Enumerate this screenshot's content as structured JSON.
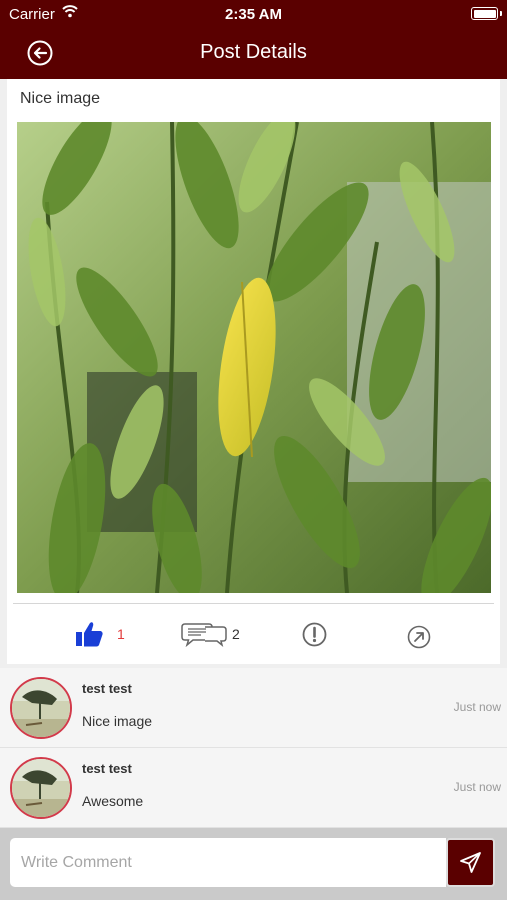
{
  "status_bar": {
    "carrier": "Carrier",
    "time": "2:35 AM",
    "wifi_icon": "wifi-icon",
    "battery_icon": "battery-icon"
  },
  "header": {
    "title": "Post Details",
    "back_icon": "back-arrow-icon"
  },
  "post": {
    "caption": "Nice image",
    "image_description_icon": "post-photo",
    "likes": "1",
    "comments": "2",
    "like_icon": "thumbs-up-icon",
    "comment_icon": "comment-bubbles-icon",
    "report_icon": "exclamation-icon",
    "share_icon": "share-arrow-icon"
  },
  "comments": [
    {
      "name": "test test",
      "text": "Nice image",
      "time": "Just now"
    },
    {
      "name": "test test",
      "text": "Awesome",
      "time": "Just now"
    }
  ],
  "composer": {
    "placeholder": "Write Comment",
    "value": "",
    "send_icon": "send-icon"
  },
  "colors": {
    "header": "#5a0000",
    "like": "#1a3fd6",
    "like_count": "#e23a3a",
    "avatar_ring": "#d23a4a"
  }
}
